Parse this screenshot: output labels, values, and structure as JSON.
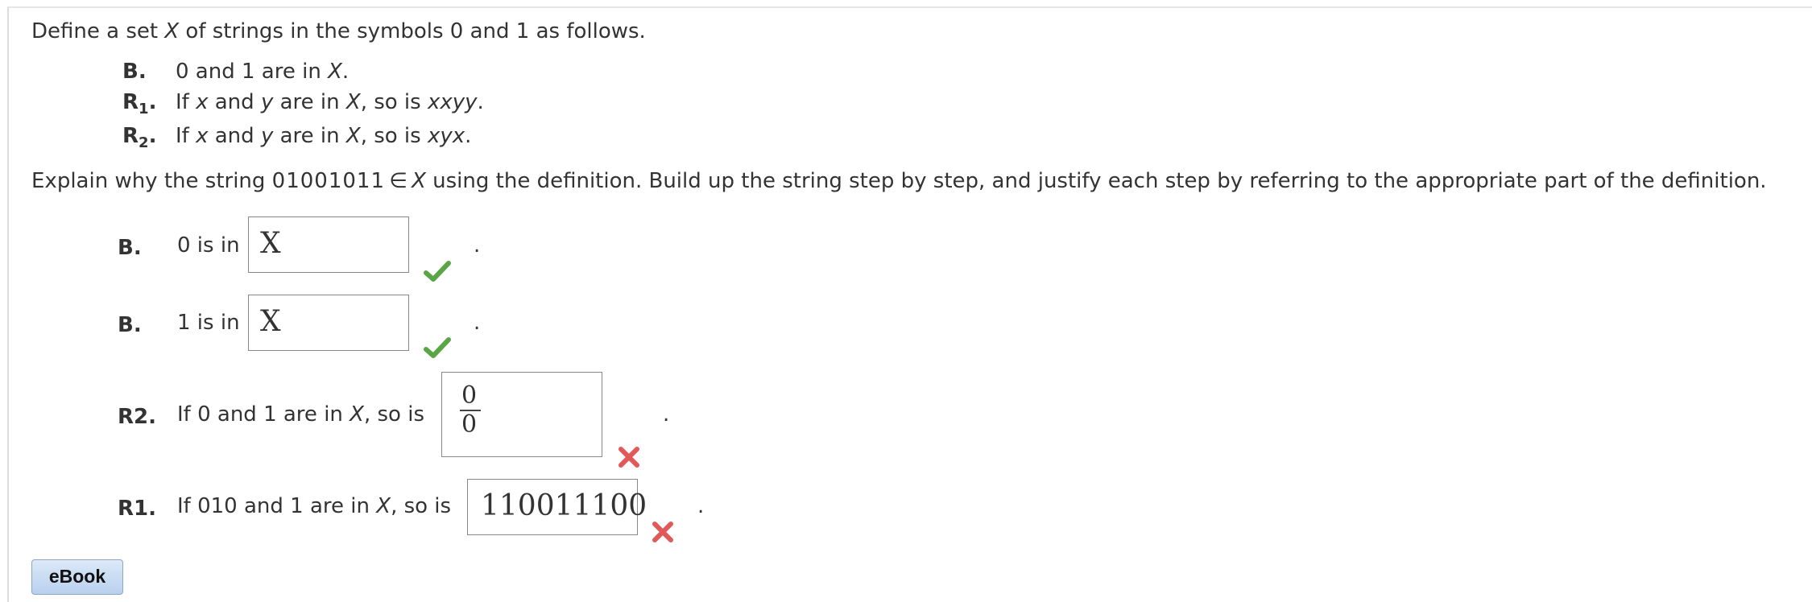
{
  "intro": {
    "prefix": "Define a set ",
    "set_var": "X",
    "suffix": " of strings in the symbols 0 and 1 as follows."
  },
  "definition": {
    "base": {
      "tag": "B.",
      "text_a": "0 and 1 are in ",
      "var": "X",
      "text_b": "."
    },
    "rule1": {
      "tag": "R",
      "sub": "1",
      "dot": ".",
      "a": "If ",
      "x": "x",
      "b": " and ",
      "y": "y",
      "c": " are in ",
      "X": "X",
      "d": ", so is ",
      "result": "xxyy",
      "e": "."
    },
    "rule2": {
      "tag": "R",
      "sub": "2",
      "dot": ".",
      "a": "If ",
      "x": "x",
      "b": " and ",
      "y": "y",
      "c": " are in ",
      "X": "X",
      "d": ", so is ",
      "result": "xyx",
      "e": "."
    }
  },
  "instruction": {
    "a": "Explain why the string ",
    "string": "01001011",
    "member": "∈",
    "set_var": "X",
    "b": " using the definition. Build up the string step by step, and justify each step by referring to the appropriate part of the definition."
  },
  "steps": [
    {
      "tag": "B.",
      "text": "0 is in",
      "answer": "X",
      "status": "correct",
      "end": "."
    },
    {
      "tag": "B.",
      "text": "1 is in",
      "answer": "X",
      "status": "correct",
      "end": "."
    },
    {
      "tag": "R2.",
      "text_a": "If 0 and 1 are in ",
      "var": "X",
      "text_b": ", so is",
      "answer_num": "0",
      "answer_den": "0",
      "status": "incorrect",
      "end": "."
    },
    {
      "tag": "R1.",
      "text_a": "If 010 and 1 are in ",
      "var": "X",
      "text_b": ", so is",
      "answer": "110011100",
      "status": "incorrect",
      "end": "."
    }
  ],
  "colors": {
    "correct": "#5aa645",
    "incorrect": "#e05a5a"
  },
  "icons": {
    "correct": "checkmark-icon",
    "incorrect": "x-mark-icon"
  },
  "ebook_label": "eBook"
}
